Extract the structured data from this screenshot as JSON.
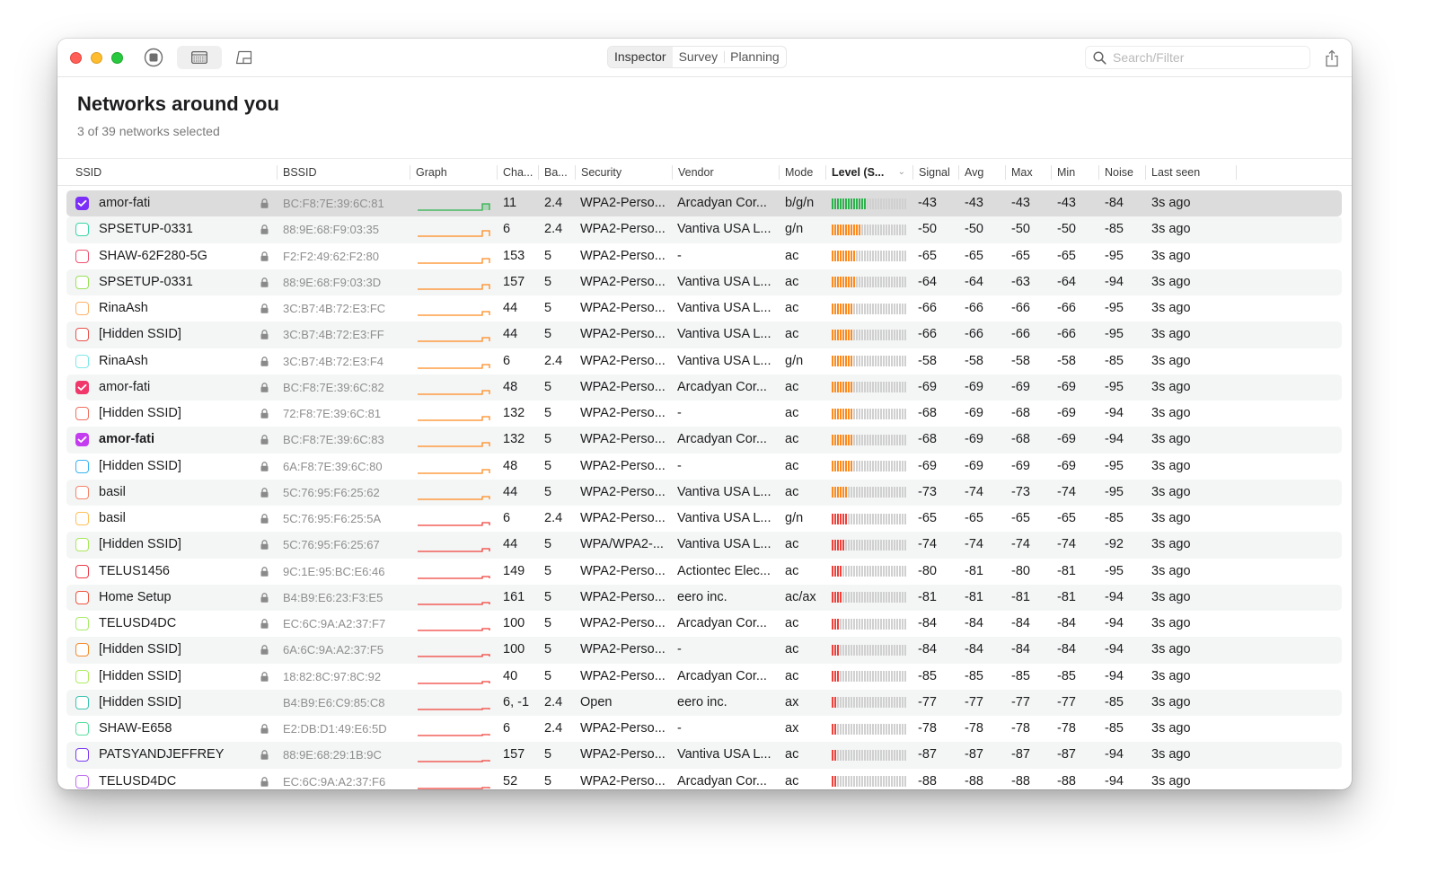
{
  "window": {
    "toolbar": {
      "stop_label": "Stop scanning",
      "table_view_label": "Table view",
      "planning_view_label": "Planning view",
      "share_label": "Share"
    },
    "tabs": [
      {
        "label": "Inspector",
        "active": true
      },
      {
        "label": "Survey",
        "active": false
      },
      {
        "label": "Planning",
        "active": false
      }
    ],
    "search": {
      "placeholder": "Search/Filter",
      "value": ""
    }
  },
  "header": {
    "title": "Networks around you",
    "subtitle": "3 of 39 networks selected"
  },
  "table": {
    "columns": [
      {
        "key": "ssid",
        "label": "SSID"
      },
      {
        "key": "bssid",
        "label": "BSSID"
      },
      {
        "key": "graph",
        "label": "Graph"
      },
      {
        "key": "channel",
        "label": "Cha..."
      },
      {
        "key": "band",
        "label": "Ba..."
      },
      {
        "key": "security",
        "label": "Security"
      },
      {
        "key": "vendor",
        "label": "Vendor"
      },
      {
        "key": "mode",
        "label": "Mode"
      },
      {
        "key": "level",
        "label": "Level (S...",
        "sorted": true
      },
      {
        "key": "signal",
        "label": "Signal"
      },
      {
        "key": "avg",
        "label": "Avg"
      },
      {
        "key": "max",
        "label": "Max"
      },
      {
        "key": "min",
        "label": "Min"
      },
      {
        "key": "noise",
        "label": "Noise"
      },
      {
        "key": "last_seen",
        "label": "Last seen"
      }
    ],
    "level_colors": {
      "strong": "#2bb24c",
      "medium": "#ff8a1e",
      "weak": "#f0403a",
      "empty": "#d0d0d0"
    },
    "rows": [
      {
        "checked": true,
        "color": "#7b2ff7",
        "ssid": "amor-fati",
        "locked": true,
        "bssid": "BC:F8:7E:39:6C:81",
        "channel": "11",
        "band": "2.4",
        "security": "WPA2-Perso...",
        "vendor": "Arcadyan Cor...",
        "mode": "b/g/n",
        "level_bars": 13,
        "level_color": "strong",
        "signal": "-43",
        "avg": "-43",
        "max": "-43",
        "min": "-43",
        "noise": "-84",
        "last_seen": "3s ago",
        "selected": true
      },
      {
        "checked": false,
        "color": "#3ad6a8",
        "ssid": "SPSETUP-0331",
        "locked": true,
        "bssid": "88:9E:68:F9:03:35",
        "channel": "6",
        "band": "2.4",
        "security": "WPA2-Perso...",
        "vendor": "Vantiva USA L...",
        "mode": "g/n",
        "level_bars": 11,
        "level_color": "medium",
        "signal": "-50",
        "avg": "-50",
        "max": "-50",
        "min": "-50",
        "noise": "-85",
        "last_seen": "3s ago"
      },
      {
        "checked": false,
        "color": "#f0506e",
        "ssid": "SHAW-62F280-5G",
        "locked": true,
        "bssid": "F2:F2:49:62:F2:80",
        "channel": "153",
        "band": "5",
        "security": "WPA2-Perso...",
        "vendor": "-",
        "mode": "ac",
        "level_bars": 9,
        "level_color": "medium",
        "signal": "-65",
        "avg": "-65",
        "max": "-65",
        "min": "-65",
        "noise": "-95",
        "last_seen": "3s ago"
      },
      {
        "checked": false,
        "color": "#9be05a",
        "ssid": "SPSETUP-0331",
        "locked": true,
        "bssid": "88:9E:68:F9:03:3D",
        "channel": "157",
        "band": "5",
        "security": "WPA2-Perso...",
        "vendor": "Vantiva USA L...",
        "mode": "ac",
        "level_bars": 9,
        "level_color": "medium",
        "signal": "-64",
        "avg": "-64",
        "max": "-63",
        "min": "-64",
        "noise": "-94",
        "last_seen": "3s ago"
      },
      {
        "checked": false,
        "color": "#ffb36b",
        "ssid": "RinaAsh",
        "locked": true,
        "bssid": "3C:B7:4B:72:E3:FC",
        "channel": "44",
        "band": "5",
        "security": "WPA2-Perso...",
        "vendor": "Vantiva USA L...",
        "mode": "ac",
        "level_bars": 8,
        "level_color": "medium",
        "signal": "-66",
        "avg": "-66",
        "max": "-66",
        "min": "-66",
        "noise": "-95",
        "last_seen": "3s ago"
      },
      {
        "checked": false,
        "color": "#e8544e",
        "ssid": "[Hidden SSID]",
        "locked": true,
        "bssid": "3C:B7:4B:72:E3:FF",
        "channel": "44",
        "band": "5",
        "security": "WPA2-Perso...",
        "vendor": "Vantiva USA L...",
        "mode": "ac",
        "level_bars": 8,
        "level_color": "medium",
        "signal": "-66",
        "avg": "-66",
        "max": "-66",
        "min": "-66",
        "noise": "-95",
        "last_seen": "3s ago"
      },
      {
        "checked": false,
        "color": "#7fe8e8",
        "ssid": "RinaAsh",
        "locked": true,
        "bssid": "3C:B7:4B:72:E3:F4",
        "channel": "6",
        "band": "2.4",
        "security": "WPA2-Perso...",
        "vendor": "Vantiva USA L...",
        "mode": "g/n",
        "level_bars": 8,
        "level_color": "medium",
        "signal": "-58",
        "avg": "-58",
        "max": "-58",
        "min": "-58",
        "noise": "-85",
        "last_seen": "3s ago"
      },
      {
        "checked": true,
        "color": "#f0386b",
        "ssid": "amor-fati",
        "locked": true,
        "bssid": "BC:F8:7E:39:6C:82",
        "channel": "48",
        "band": "5",
        "security": "WPA2-Perso...",
        "vendor": "Arcadyan Cor...",
        "mode": "ac",
        "level_bars": 8,
        "level_color": "medium",
        "signal": "-69",
        "avg": "-69",
        "max": "-69",
        "min": "-69",
        "noise": "-95",
        "last_seen": "3s ago"
      },
      {
        "checked": false,
        "color": "#f07060",
        "ssid": "[Hidden SSID]",
        "locked": true,
        "bssid": "72:F8:7E:39:6C:81",
        "channel": "132",
        "band": "5",
        "security": "WPA2-Perso...",
        "vendor": "-",
        "mode": "ac",
        "level_bars": 8,
        "level_color": "medium",
        "signal": "-68",
        "avg": "-69",
        "max": "-68",
        "min": "-69",
        "noise": "-94",
        "last_seen": "3s ago"
      },
      {
        "checked": true,
        "color": "#c43cf0",
        "ssid": "amor-fati",
        "bold": true,
        "locked": true,
        "bssid": "BC:F8:7E:39:6C:83",
        "channel": "132",
        "band": "5",
        "security": "WPA2-Perso...",
        "vendor": "Arcadyan Cor...",
        "mode": "ac",
        "level_bars": 8,
        "level_color": "medium",
        "signal": "-68",
        "avg": "-69",
        "max": "-68",
        "min": "-69",
        "noise": "-94",
        "last_seen": "3s ago"
      },
      {
        "checked": false,
        "color": "#38b4f0",
        "ssid": "[Hidden SSID]",
        "locked": true,
        "bssid": "6A:F8:7E:39:6C:80",
        "channel": "48",
        "band": "5",
        "security": "WPA2-Perso...",
        "vendor": "-",
        "mode": "ac",
        "level_bars": 8,
        "level_color": "medium",
        "signal": "-69",
        "avg": "-69",
        "max": "-69",
        "min": "-69",
        "noise": "-95",
        "last_seen": "3s ago"
      },
      {
        "checked": false,
        "color": "#f5846a",
        "ssid": "basil",
        "locked": true,
        "bssid": "5C:76:95:F6:25:62",
        "channel": "44",
        "band": "5",
        "security": "WPA2-Perso...",
        "vendor": "Vantiva USA L...",
        "mode": "ac",
        "level_bars": 6,
        "level_color": "medium",
        "signal": "-73",
        "avg": "-74",
        "max": "-73",
        "min": "-74",
        "noise": "-95",
        "last_seen": "3s ago"
      },
      {
        "checked": false,
        "color": "#ffc05a",
        "ssid": "basil",
        "locked": true,
        "bssid": "5C:76:95:F6:25:5A",
        "channel": "6",
        "band": "2.4",
        "security": "WPA2-Perso...",
        "vendor": "Vantiva USA L...",
        "mode": "g/n",
        "level_bars": 6,
        "level_color": "weak",
        "signal": "-65",
        "avg": "-65",
        "max": "-65",
        "min": "-65",
        "noise": "-85",
        "last_seen": "3s ago"
      },
      {
        "checked": false,
        "color": "#a8e85a",
        "ssid": "[Hidden SSID]",
        "locked": true,
        "bssid": "5C:76:95:F6:25:67",
        "channel": "44",
        "band": "5",
        "security": "WPA/WPA2-...",
        "vendor": "Vantiva USA L...",
        "mode": "ac",
        "level_bars": 5,
        "level_color": "weak",
        "signal": "-74",
        "avg": "-74",
        "max": "-74",
        "min": "-74",
        "noise": "-92",
        "last_seen": "3s ago"
      },
      {
        "checked": false,
        "color": "#ec3b4a",
        "ssid": "TELUS1456",
        "locked": true,
        "bssid": "9C:1E:95:BC:E6:46",
        "channel": "149",
        "band": "5",
        "security": "WPA2-Perso...",
        "vendor": "Actiontec Elec...",
        "mode": "ac",
        "level_bars": 4,
        "level_color": "weak",
        "signal": "-80",
        "avg": "-81",
        "max": "-80",
        "min": "-81",
        "noise": "-95",
        "last_seen": "3s ago"
      },
      {
        "checked": false,
        "color": "#f0553c",
        "ssid": "Home Setup",
        "locked": true,
        "bssid": "B4:B9:E6:23:F3:E5",
        "channel": "161",
        "band": "5",
        "security": "WPA2-Perso...",
        "vendor": "eero inc.",
        "mode": "ac/ax",
        "level_bars": 4,
        "level_color": "weak",
        "signal": "-81",
        "avg": "-81",
        "max": "-81",
        "min": "-81",
        "noise": "-94",
        "last_seen": "3s ago"
      },
      {
        "checked": false,
        "color": "#a8ec6a",
        "ssid": "TELUSD4DC",
        "locked": true,
        "bssid": "EC:6C:9A:A2:37:F7",
        "channel": "100",
        "band": "5",
        "security": "WPA2-Perso...",
        "vendor": "Arcadyan Cor...",
        "mode": "ac",
        "level_bars": 3,
        "level_color": "weak",
        "signal": "-84",
        "avg": "-84",
        "max": "-84",
        "min": "-84",
        "noise": "-94",
        "last_seen": "3s ago"
      },
      {
        "checked": false,
        "color": "#f58a2a",
        "ssid": "[Hidden SSID]",
        "locked": true,
        "bssid": "6A:6C:9A:A2:37:F5",
        "channel": "100",
        "band": "5",
        "security": "WPA2-Perso...",
        "vendor": "-",
        "mode": "ac",
        "level_bars": 3,
        "level_color": "weak",
        "signal": "-84",
        "avg": "-84",
        "max": "-84",
        "min": "-84",
        "noise": "-94",
        "last_seen": "3s ago"
      },
      {
        "checked": false,
        "color": "#b0ec60",
        "ssid": "[Hidden SSID]",
        "locked": true,
        "bssid": "18:82:8C:97:8C:92",
        "channel": "40",
        "band": "5",
        "security": "WPA2-Perso...",
        "vendor": "Arcadyan Cor...",
        "mode": "ac",
        "level_bars": 3,
        "level_color": "weak",
        "signal": "-85",
        "avg": "-85",
        "max": "-85",
        "min": "-85",
        "noise": "-94",
        "last_seen": "3s ago"
      },
      {
        "checked": false,
        "color": "#3cc4b0",
        "ssid": "[Hidden SSID]",
        "locked": false,
        "bssid": "B4:B9:E6:C9:85:C8",
        "channel": "6, -1",
        "band": "2.4",
        "security": "Open",
        "vendor": "eero inc.",
        "mode": "ax",
        "level_bars": 2,
        "level_color": "weak",
        "signal": "-77",
        "avg": "-77",
        "max": "-77",
        "min": "-77",
        "noise": "-85",
        "last_seen": "3s ago"
      },
      {
        "checked": false,
        "color": "#5ae0a0",
        "ssid": "SHAW-E658",
        "locked": true,
        "bssid": "E2:DB:D1:49:E6:5D",
        "channel": "6",
        "band": "2.4",
        "security": "WPA2-Perso...",
        "vendor": "-",
        "mode": "ax",
        "level_bars": 2,
        "level_color": "weak",
        "signal": "-78",
        "avg": "-78",
        "max": "-78",
        "min": "-78",
        "noise": "-85",
        "last_seen": "3s ago"
      },
      {
        "checked": false,
        "color": "#7a3cf0",
        "ssid": "PATSYANDJEFFREY",
        "locked": true,
        "bssid": "88:9E:68:29:1B:9C",
        "channel": "157",
        "band": "5",
        "security": "WPA2-Perso...",
        "vendor": "Vantiva USA L...",
        "mode": "ac",
        "level_bars": 2,
        "level_color": "weak",
        "signal": "-87",
        "avg": "-87",
        "max": "-87",
        "min": "-87",
        "noise": "-94",
        "last_seen": "3s ago"
      },
      {
        "checked": false,
        "color": "#c070f0",
        "ssid": "TELUSD4DC",
        "locked": true,
        "bssid": "EC:6C:9A:A2:37:F6",
        "channel": "52",
        "band": "5",
        "security": "WPA2-Perso...",
        "vendor": "Arcadyan Cor...",
        "mode": "ac",
        "level_bars": 2,
        "level_color": "weak",
        "signal": "-88",
        "avg": "-88",
        "max": "-88",
        "min": "-88",
        "noise": "-94",
        "last_seen": "3s ago"
      }
    ]
  }
}
